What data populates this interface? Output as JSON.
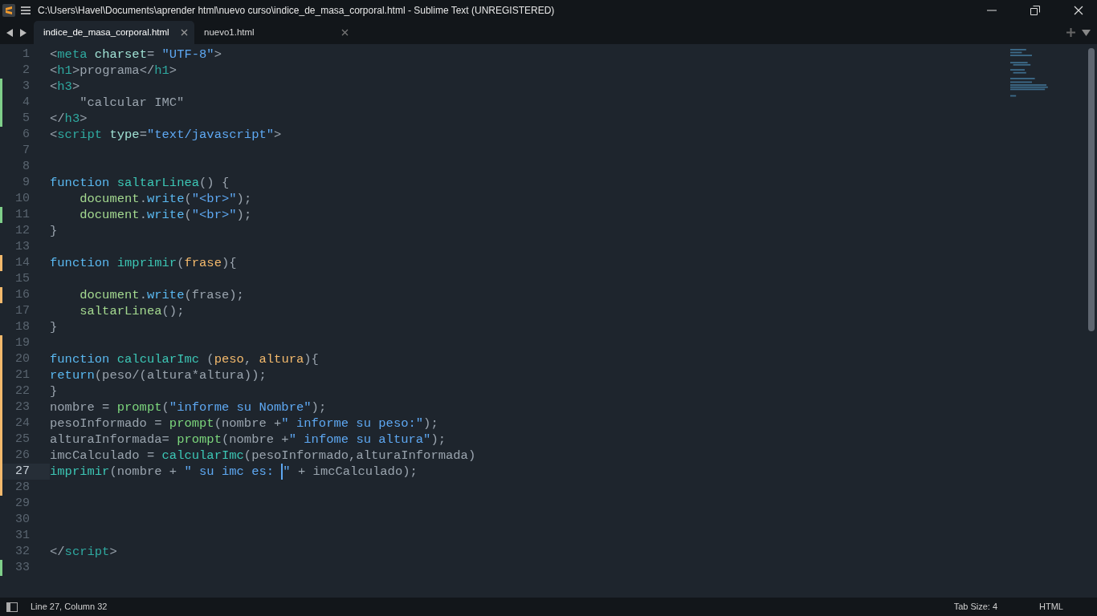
{
  "window": {
    "title": "C:\\Users\\Havel\\Documents\\aprender html\\nuevo curso\\indice_de_masa_corporal.html - Sublime Text (UNREGISTERED)"
  },
  "tabs": [
    {
      "label": "indice_de_masa_corporal.html",
      "selected": true
    },
    {
      "label": "nuevo1.html",
      "selected": false
    }
  ],
  "editor": {
    "lines": [
      {
        "number": "1",
        "kind": "unchanged",
        "current": false,
        "tokens": [
          {
            "t": "<",
            "kind": "punct"
          },
          {
            "t": "meta",
            "kind": "tag"
          },
          {
            "t": " charset",
            "kind": "attr"
          },
          {
            "t": "= ",
            "kind": "punct"
          },
          {
            "t": "\"UTF-8\"",
            "kind": "string"
          },
          {
            "t": ">",
            "kind": "punct"
          }
        ]
      },
      {
        "number": "2",
        "kind": "unchanged",
        "current": false,
        "tokens": [
          {
            "t": "<",
            "kind": "punct"
          },
          {
            "t": "h1",
            "kind": "tag"
          },
          {
            "t": ">programa</",
            "kind": "punct"
          },
          {
            "t": "h1",
            "kind": "tag"
          },
          {
            "t": ">",
            "kind": "punct"
          }
        ]
      },
      {
        "number": "3",
        "kind": "added",
        "current": false,
        "tokens": [
          {
            "t": "<",
            "kind": "punct"
          },
          {
            "t": "h3",
            "kind": "tag"
          },
          {
            "t": ">",
            "kind": "punct"
          }
        ]
      },
      {
        "number": "4",
        "kind": "added",
        "current": false,
        "indented": true,
        "tokens": [
          {
            "t": "\"calcular IMC\"",
            "kind": "plain"
          }
        ]
      },
      {
        "number": "5",
        "kind": "added",
        "current": false,
        "tokens": [
          {
            "t": "</",
            "kind": "punct"
          },
          {
            "t": "h3",
            "kind": "tag"
          },
          {
            "t": ">",
            "kind": "punct"
          }
        ]
      },
      {
        "number": "6",
        "kind": "unchanged",
        "current": false,
        "tokens": [
          {
            "t": "<",
            "kind": "punct"
          },
          {
            "t": "script",
            "kind": "tag"
          },
          {
            "t": " type",
            "kind": "attr"
          },
          {
            "t": "=",
            "kind": "punct"
          },
          {
            "t": "\"text/javascript\"",
            "kind": "string"
          },
          {
            "t": ">",
            "kind": "punct"
          }
        ]
      },
      {
        "number": "7",
        "kind": "unchanged",
        "current": false
      },
      {
        "number": "8",
        "kind": "unchanged",
        "current": false
      },
      {
        "number": "9",
        "kind": "unchanged",
        "current": false,
        "tokens": [
          {
            "t": "function",
            "kind": "keyword"
          },
          {
            "t": " saltarLinea",
            "kind": "fn"
          },
          {
            "t": "() {",
            "kind": "punct"
          }
        ]
      },
      {
        "number": "10",
        "kind": "unchanged",
        "current": false,
        "indented": true,
        "tokens": [
          {
            "t": "document",
            "kind": "obj"
          },
          {
            "t": ".",
            "kind": "punct"
          },
          {
            "t": "write",
            "kind": "method"
          },
          {
            "t": "(",
            "kind": "punct"
          },
          {
            "t": "\"<br>\"",
            "kind": "string"
          },
          {
            "t": ");",
            "kind": "punct"
          }
        ]
      },
      {
        "number": "11",
        "kind": "added",
        "current": false,
        "indented": true,
        "tokens": [
          {
            "t": "document",
            "kind": "obj"
          },
          {
            "t": ".",
            "kind": "punct"
          },
          {
            "t": "write",
            "kind": "method"
          },
          {
            "t": "(",
            "kind": "punct"
          },
          {
            "t": "\"<br>\"",
            "kind": "string"
          },
          {
            "t": ");",
            "kind": "punct"
          }
        ]
      },
      {
        "number": "12",
        "kind": "unchanged",
        "current": false,
        "tokens": [
          {
            "t": "}",
            "kind": "punct"
          }
        ]
      },
      {
        "number": "13",
        "kind": "unchanged",
        "current": false
      },
      {
        "number": "14",
        "kind": "modified",
        "current": false,
        "tokens": [
          {
            "t": "function",
            "kind": "keyword"
          },
          {
            "t": " imprimir",
            "kind": "fn"
          },
          {
            "t": "(",
            "kind": "punct"
          },
          {
            "t": "frase",
            "kind": "param"
          },
          {
            "t": "){",
            "kind": "punct"
          }
        ]
      },
      {
        "number": "15",
        "kind": "unchanged",
        "current": false
      },
      {
        "number": "16",
        "kind": "modified",
        "current": false,
        "indented": true,
        "tokens": [
          {
            "t": "document",
            "kind": "obj"
          },
          {
            "t": ".",
            "kind": "punct"
          },
          {
            "t": "write",
            "kind": "method"
          },
          {
            "t": "(frase);",
            "kind": "punct"
          }
        ]
      },
      {
        "number": "17",
        "kind": "unchanged",
        "current": false,
        "indented": true,
        "tokens": [
          {
            "t": "saltarLinea",
            "kind": "obj"
          },
          {
            "t": "();",
            "kind": "punct"
          }
        ]
      },
      {
        "number": "18",
        "kind": "unchanged",
        "current": false,
        "tokens": [
          {
            "t": "}",
            "kind": "punct"
          }
        ]
      },
      {
        "number": "19",
        "kind": "modified",
        "current": false
      },
      {
        "number": "20",
        "kind": "modified",
        "current": false,
        "tokens": [
          {
            "t": "function",
            "kind": "keyword"
          },
          {
            "t": " calcularImc",
            "kind": "fn"
          },
          {
            "t": " (",
            "kind": "punct"
          },
          {
            "t": "peso",
            "kind": "param"
          },
          {
            "t": ", ",
            "kind": "punct"
          },
          {
            "t": "altura",
            "kind": "param"
          },
          {
            "t": "){",
            "kind": "punct"
          }
        ]
      },
      {
        "number": "21",
        "kind": "modified",
        "current": false,
        "tokens": [
          {
            "t": "return",
            "kind": "keyword"
          },
          {
            "t": "(peso/(altura*altura));",
            "kind": "punct"
          }
        ]
      },
      {
        "number": "22",
        "kind": "modified",
        "current": false,
        "tokens": [
          {
            "t": "}",
            "kind": "punct"
          }
        ]
      },
      {
        "number": "23",
        "kind": "modified",
        "current": false,
        "tokens": [
          {
            "t": "nombre = ",
            "kind": "plain"
          },
          {
            "t": "prompt",
            "kind": "call"
          },
          {
            "t": "(",
            "kind": "punct"
          },
          {
            "t": "\"informe su Nombre\"",
            "kind": "string"
          },
          {
            "t": ");",
            "kind": "punct"
          }
        ]
      },
      {
        "number": "24",
        "kind": "modified",
        "current": false,
        "tokens": [
          {
            "t": "pesoInformado = ",
            "kind": "plain"
          },
          {
            "t": "prompt",
            "kind": "call"
          },
          {
            "t": "(nombre +",
            "kind": "punct"
          },
          {
            "t": "\" informe su peso:\"",
            "kind": "string"
          },
          {
            "t": ");",
            "kind": "punct"
          }
        ]
      },
      {
        "number": "25",
        "kind": "modified",
        "current": false,
        "tokens": [
          {
            "t": "alturaInformada= ",
            "kind": "plain"
          },
          {
            "t": "prompt",
            "kind": "call"
          },
          {
            "t": "(nombre +",
            "kind": "punct"
          },
          {
            "t": "\" infome su altura\"",
            "kind": "string"
          },
          {
            "t": ");",
            "kind": "punct"
          }
        ]
      },
      {
        "number": "26",
        "kind": "modified",
        "current": false,
        "tokens": [
          {
            "t": "imcCalculado = ",
            "kind": "plain"
          },
          {
            "t": "calcularImc",
            "kind": "fn"
          },
          {
            "t": "(pesoInformado,alturaInformada)",
            "kind": "punct"
          }
        ]
      },
      {
        "number": "27",
        "kind": "modified",
        "current": true,
        "tokens": [
          {
            "t": "imprimir",
            "kind": "fn"
          },
          {
            "t": "(nombre + ",
            "kind": "punct"
          },
          {
            "t": "\" su imc es: ",
            "kind": "string"
          },
          {
            "kind": "caret"
          },
          {
            "t": "\"",
            "kind": "string"
          },
          {
            "t": " + imcCalculado);",
            "kind": "punct"
          }
        ]
      },
      {
        "number": "28",
        "kind": "modified",
        "current": false
      },
      {
        "number": "29",
        "kind": "unchanged",
        "current": false
      },
      {
        "number": "30",
        "kind": "unchanged",
        "current": false
      },
      {
        "number": "31",
        "kind": "unchanged",
        "current": false
      },
      {
        "number": "32",
        "kind": "unchanged",
        "current": false,
        "tokens": [
          {
            "t": "</",
            "kind": "punct"
          },
          {
            "t": "script",
            "kind": "tag"
          },
          {
            "t": ">",
            "kind": "punct"
          }
        ]
      },
      {
        "number": "33",
        "kind": "added",
        "current": false
      }
    ]
  },
  "status_bar": {
    "position": "Line 27, Column 32",
    "tab_size": "Tab Size: 4",
    "syntax": "HTML"
  }
}
